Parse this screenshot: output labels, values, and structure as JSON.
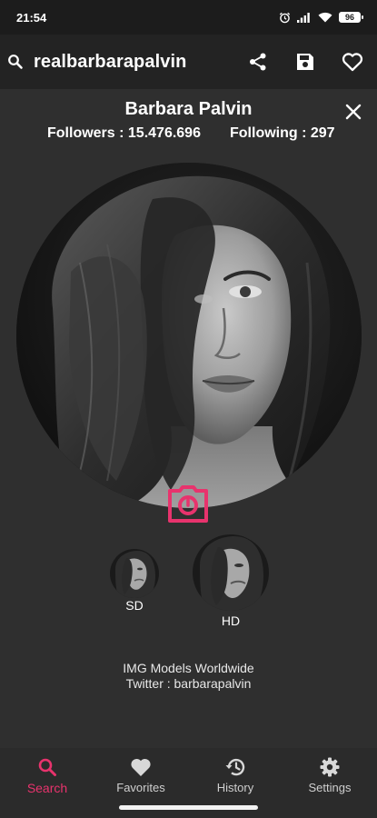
{
  "status_bar": {
    "time": "21:54",
    "battery": "96",
    "icons": [
      "alarm-icon",
      "signal-icon",
      "wifi-icon",
      "battery-icon"
    ]
  },
  "app_bar": {
    "search_query": "realbarbarapalvin",
    "icons": [
      "search-icon",
      "share-icon",
      "save-icon",
      "heart-outline-icon"
    ]
  },
  "profile": {
    "name": "Barbara Palvin",
    "followers": "Followers : 15.476.696",
    "following": "Following : 297"
  },
  "photo_options": {
    "sd_label": "SD",
    "hd_label": "HD"
  },
  "bio": {
    "line1": "IMG Models Worldwide",
    "line2": "Twitter : barbarapalvin"
  },
  "bottom_nav": {
    "items": [
      {
        "label": "Search",
        "icon": "search-icon",
        "active": true
      },
      {
        "label": "Favorites",
        "icon": "heart-icon",
        "active": false
      },
      {
        "label": "History",
        "icon": "history-icon",
        "active": false
      },
      {
        "label": "Settings",
        "icon": "gear-icon",
        "active": false
      }
    ]
  },
  "colors": {
    "accent": "#e8336d",
    "background": "#2f2f2f",
    "app_bar": "#232323",
    "status_bar": "#1c1c1c"
  }
}
